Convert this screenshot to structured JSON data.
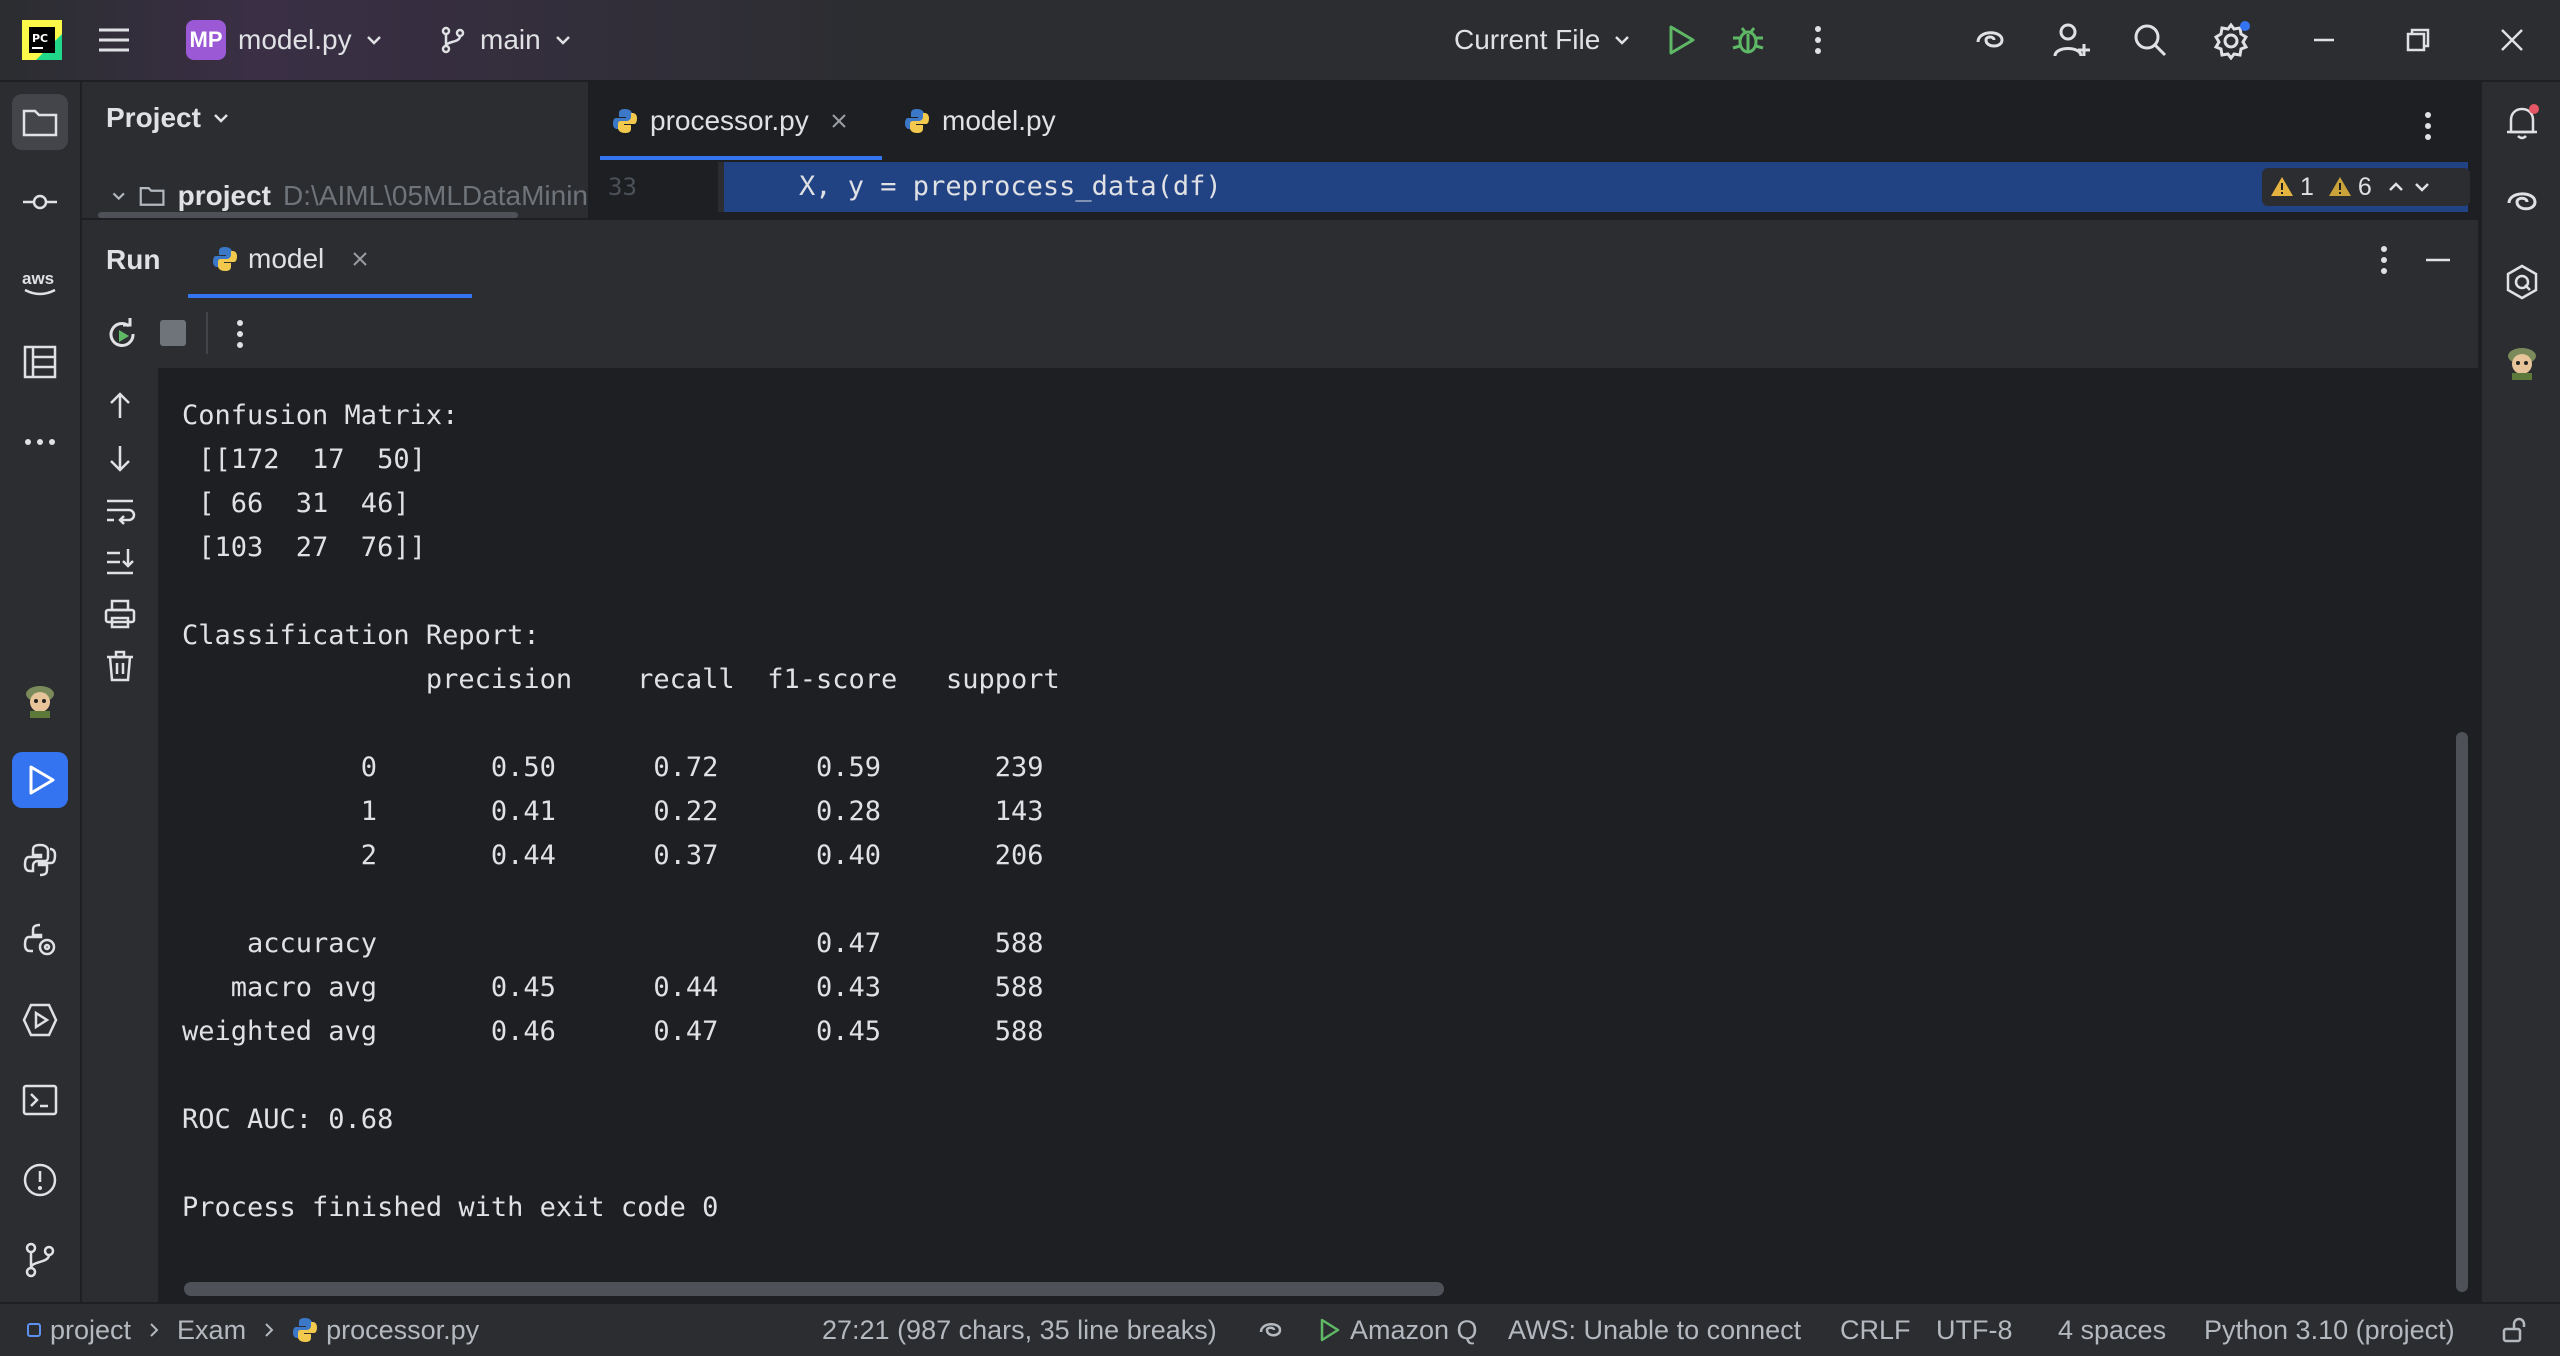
{
  "titlebar": {
    "project_badge": "MP",
    "project_name": "model.py",
    "branch": "main",
    "run_config": "Current File"
  },
  "project_panel": {
    "title": "Project",
    "root_name": "project",
    "root_path": "D:\\AIML\\05MLDataMinin"
  },
  "editor": {
    "tabs": [
      {
        "label": "processor.py",
        "active": true
      },
      {
        "label": "model.py",
        "active": false
      }
    ],
    "line_number": "33",
    "code_line": "    X, y = preprocess_data(df)",
    "error_count": "1",
    "warning_count": "6"
  },
  "run_window": {
    "title": "Run",
    "tab_label": "model"
  },
  "console_output": [
    "Confusion Matrix:",
    " [[172  17  50]",
    " [ 66  31  46]",
    " [103  27  76]]",
    "",
    "Classification Report:",
    "               precision    recall  f1-score   support",
    "",
    "           0       0.50      0.72      0.59       239",
    "           1       0.41      0.22      0.28       143",
    "           2       0.44      0.37      0.40       206",
    "",
    "    accuracy                           0.47       588",
    "   macro avg       0.45      0.44      0.43       588",
    "weighted avg       0.46      0.47      0.45       588",
    "",
    "ROC AUC: 0.68",
    "",
    "Process finished with exit code 0"
  ],
  "statusbar": {
    "breadcrumb": [
      "project",
      "Exam",
      "processor.py"
    ],
    "cursor_info": "27:21 (987 chars, 35 line breaks)",
    "amazon_q": "Amazon Q",
    "aws_status": "AWS: Unable to connect",
    "line_separator": "CRLF",
    "encoding": "UTF-8",
    "indent": "4 spaces",
    "interpreter": "Python 3.10 (project)"
  },
  "colors": {
    "accent": "#3574f0",
    "run_green": "#5fb865",
    "selection": "#214283",
    "warning": "#e5b33f"
  }
}
